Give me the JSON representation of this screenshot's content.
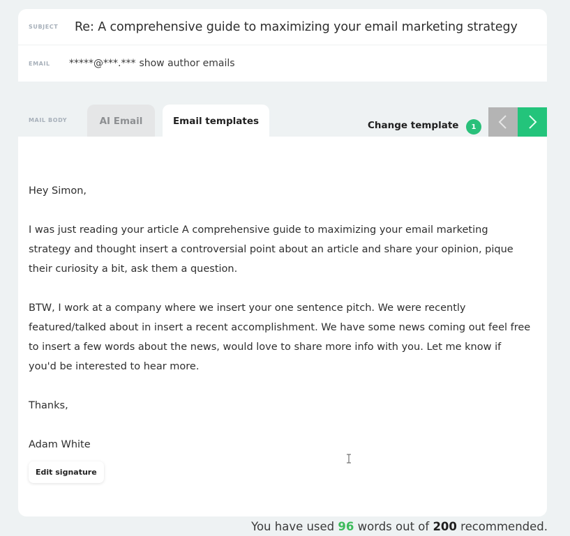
{
  "header": {
    "subject_label": "SUBJECT",
    "subject_value": "Re: A comprehensive guide to maximizing your email marketing strategy",
    "email_label": "EMAIL",
    "email_masked": "*****@***.***",
    "show_emails_link": "show author emails"
  },
  "mail_body": {
    "label": "MAIL BODY",
    "tabs": [
      {
        "label": "AI Email",
        "active": false
      },
      {
        "label": "Email templates",
        "active": true
      }
    ],
    "change_template_label": "Change template",
    "template_count": "1",
    "prev_icon": "chevron-left-icon",
    "next_icon": "chevron-right-icon"
  },
  "email": {
    "greeting": "Hey Simon,",
    "paragraph_1": "I was just reading your article A comprehensive guide to maximizing your email marketing strategy and thought insert a controversial point about an article and share your opinion, pique their curiosity a bit, ask them a question.",
    "paragraph_2": "BTW, I work at a company where we insert your one sentence pitch. We were recently featured/talked about in insert a recent accomplishment. We have some news coming out feel free to insert a few words about the news, would love to share more info with you. Let me know if you'd be interested to hear more.",
    "closing": "Thanks,",
    "signature_name": "Adam White",
    "edit_signature_label": "Edit signature"
  },
  "word_count": {
    "prefix": "You have used",
    "used": "96",
    "middle": "words out of",
    "recommended": "200",
    "suffix": "recommended."
  },
  "colors": {
    "accent_green": "#23c47b",
    "nav_prev_gray": "#b4b4b4",
    "used_words_green": "#3dbb5b",
    "background": "#eef2f3"
  }
}
